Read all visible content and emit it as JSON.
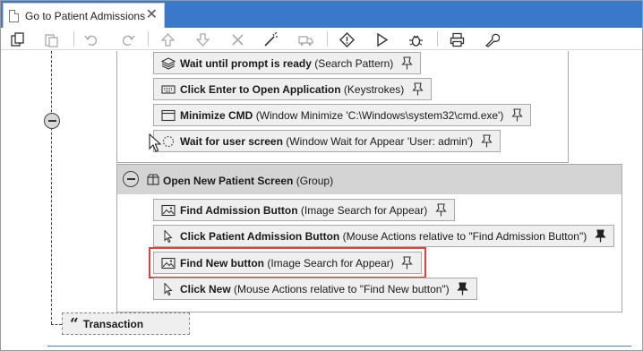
{
  "tab": {
    "title": "Go to Patient Admissions",
    "icon": "document-icon",
    "close": "✕"
  },
  "toolbar": {
    "buttons": [
      "copy-icon",
      "paste-icon",
      "undo-icon",
      "redo-icon",
      "move-up-icon",
      "move-down-icon",
      "delete-icon",
      "magic-wand-icon",
      "truck-icon",
      "diamond-icon",
      "play-icon",
      "bug-icon",
      "print-icon",
      "wrench-icon"
    ]
  },
  "steps": [
    {
      "name": "Wait until prompt is ready",
      "detail": "(Search Pattern)",
      "icon": "layers-icon",
      "pinned": false
    },
    {
      "name": "Click Enter to Open Application",
      "detail": "(Keystrokes)",
      "icon": "keyboard-icon",
      "pinned": false
    },
    {
      "name": "Minimize CMD",
      "detail": "(Window Minimize 'C:\\Windows\\system32\\cmd.exe')",
      "icon": "window-icon",
      "pinned": false
    },
    {
      "name": "Wait for user screen",
      "detail": "(Window Wait for Appear 'User: admin')",
      "icon": "spinner-icon",
      "pinned": false
    }
  ],
  "group": {
    "title": "Open New Patient Screen",
    "detail": "(Group)",
    "icon": "group-icon",
    "steps": [
      {
        "name": "Find Admission Button",
        "detail": "(Image Search for Appear)",
        "icon": "image-icon",
        "pinned": false
      },
      {
        "name": "Click Patient Admission Button",
        "detail": "(Mouse Actions relative to \"Find Admission Button\")",
        "icon": "cursor-icon",
        "pinned": true
      },
      {
        "name": "Find New button",
        "detail": "(Image Search for Appear)",
        "icon": "image-icon",
        "pinned": false,
        "selected": true
      },
      {
        "name": "Click New",
        "detail": "(Mouse Actions relative to \"Find New button\")",
        "icon": "cursor-icon",
        "pinned": true
      }
    ]
  },
  "transaction": {
    "label": "Transaction",
    "icon": "quote-icon"
  },
  "colors": {
    "tab_strip": "#3a78c9",
    "selection_outline": "#e0413a",
    "group_header": "#d4d4d4",
    "step_bg": "#efefef"
  }
}
